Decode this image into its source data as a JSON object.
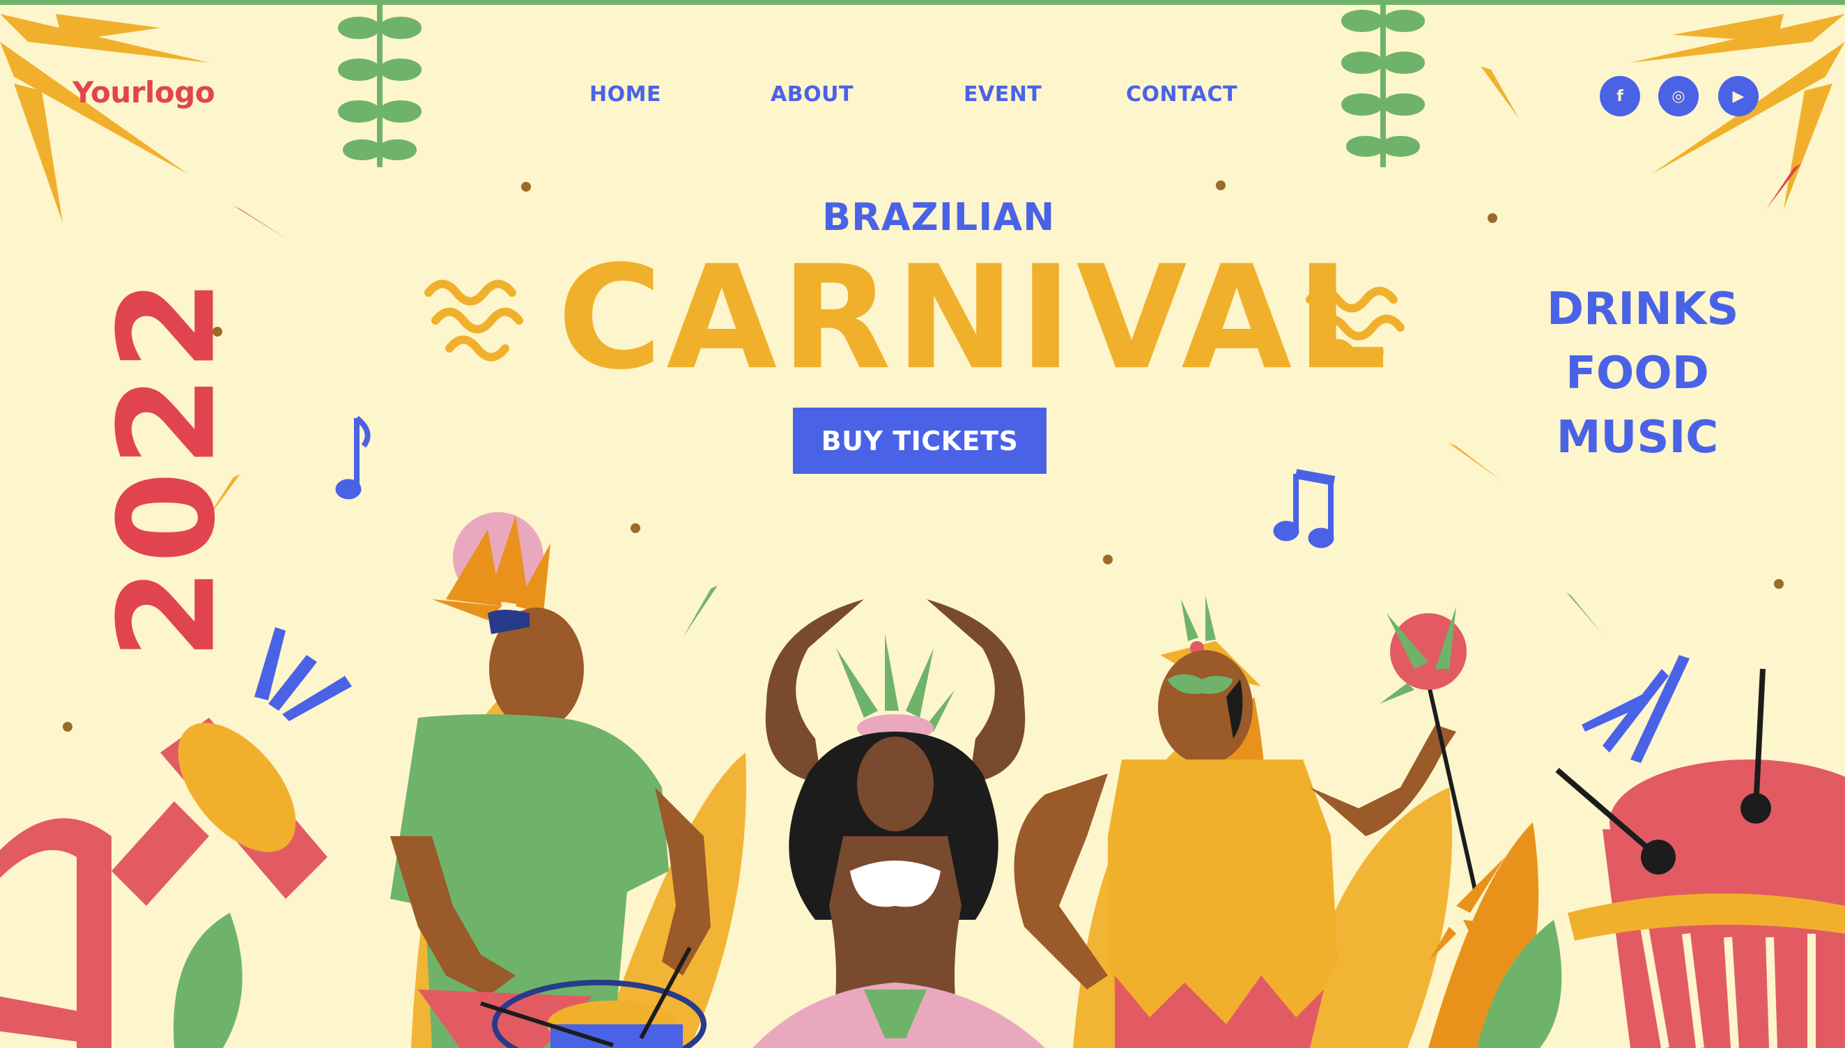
{
  "brand": {
    "logo_text": "Yourlogo"
  },
  "nav": {
    "items": [
      "HOME",
      "ABOUT",
      "EVENT",
      "CONTACT"
    ]
  },
  "social": [
    {
      "icon": "facebook-icon",
      "glyph": "f"
    },
    {
      "icon": "instagram-icon",
      "glyph": "◎"
    },
    {
      "icon": "youtube-icon",
      "glyph": "▶"
    }
  ],
  "hero": {
    "subtitle": "BRAZILIAN",
    "title": "CARNIVAL",
    "cta": "BUY TICKETS",
    "year": "2022"
  },
  "features": [
    "DRINKS",
    "FOOD",
    "MUSIC"
  ],
  "colors": {
    "background": "#fdf5cb",
    "accent_blue": "#4a62e6",
    "accent_red": "#e0454f",
    "accent_yellow": "#f0b02c",
    "accent_green": "#6fb36a"
  }
}
